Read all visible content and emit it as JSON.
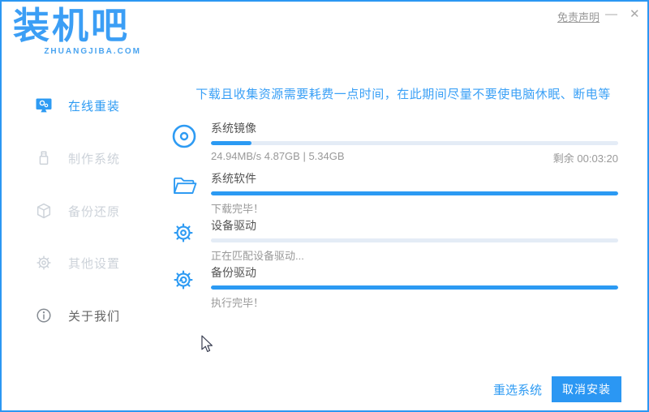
{
  "header": {
    "logo_title": "装机吧",
    "logo_subtitle": "ZHUANGJIBA.COM",
    "disclaimer": "免责声明",
    "minimize_glyph": "—",
    "close_glyph": "✕"
  },
  "sidebar": {
    "items": [
      {
        "label": "在线重装",
        "icon": "monitor-icon",
        "active": true
      },
      {
        "label": "制作系统",
        "icon": "usb-drive-icon",
        "active": false
      },
      {
        "label": "备份还原",
        "icon": "backup-box-icon",
        "active": false
      },
      {
        "label": "其他设置",
        "icon": "gear-icon",
        "active": false
      },
      {
        "label": "关于我们",
        "icon": "info-icon",
        "active": false
      }
    ]
  },
  "main": {
    "notice": "下载且收集资源需要耗费一点时间，在此期间尽量不要使电脑休眠、断电等",
    "tasks": [
      {
        "title": "系统镜像",
        "icon": "disc-icon",
        "progress": 10,
        "status_left": "24.94MB/s 4.87GB | 5.34GB",
        "status_right": "剩余 00:03:20"
      },
      {
        "title": "系统软件",
        "icon": "folder-open-icon",
        "progress": 100,
        "status_left": "下载完毕！",
        "status_right": ""
      },
      {
        "title": "设备驱动",
        "icon": "gear-icon",
        "progress": 0,
        "status_left": "正在匹配设备驱动...",
        "status_right": ""
      },
      {
        "title": "备份驱动",
        "icon": "gear-refresh-icon",
        "progress": 100,
        "status_left": "执行完毕！",
        "status_right": ""
      }
    ]
  },
  "footer": {
    "reselect_label": "重选系统",
    "cancel_label": "取消安装"
  },
  "colors": {
    "accent": "#2e9bf3",
    "progress_fill": "#2b9af3",
    "progress_track": "#e4ecf6",
    "notice_text": "#3aa0f6",
    "inactive_gray": "#ccd2d9",
    "status_gray": "#999999",
    "border": "#2b97f3"
  }
}
